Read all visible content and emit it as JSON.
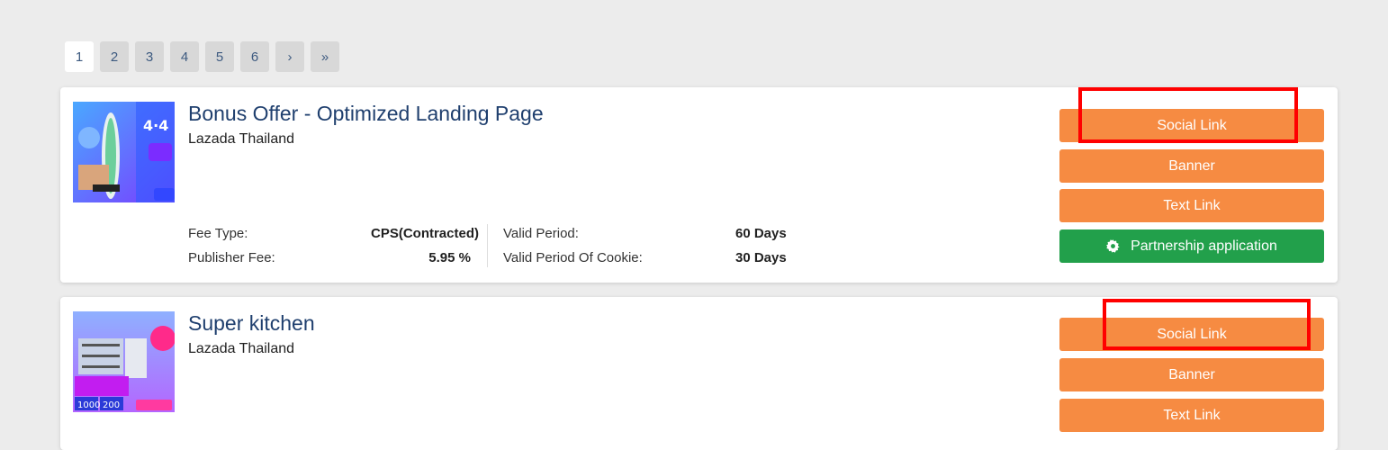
{
  "pagination": {
    "pages": [
      "1",
      "2",
      "3",
      "4",
      "5",
      "6"
    ],
    "next": "›",
    "last": "»",
    "active": "1"
  },
  "offers": [
    {
      "title": "Bonus Offer - Optimized Landing Page",
      "merchant": "Lazada Thailand",
      "fee_type_label": "Fee Type:",
      "fee_type_value": "CPS(Contracted)",
      "publisher_fee_label": "Publisher Fee:",
      "publisher_fee_value": "5.95 %",
      "valid_period_label": "Valid Period:",
      "valid_period_value": "60 Days",
      "cookie_label": "Valid Period Of Cookie:",
      "cookie_value": "30 Days",
      "buttons": {
        "social": "Social Link",
        "banner": "Banner",
        "text": "Text Link",
        "partnership": "Partnership application"
      }
    },
    {
      "title": "Super kitchen",
      "merchant": "Lazada Thailand",
      "buttons": {
        "social": "Social Link",
        "banner": "Banner",
        "text": "Text Link"
      }
    }
  ],
  "colors": {
    "orange_button": "#f68b42",
    "green_button": "#22a04b",
    "title_blue": "#1f3f6e",
    "highlight_red": "#ff0000"
  },
  "icons": [
    "gear-icon"
  ]
}
